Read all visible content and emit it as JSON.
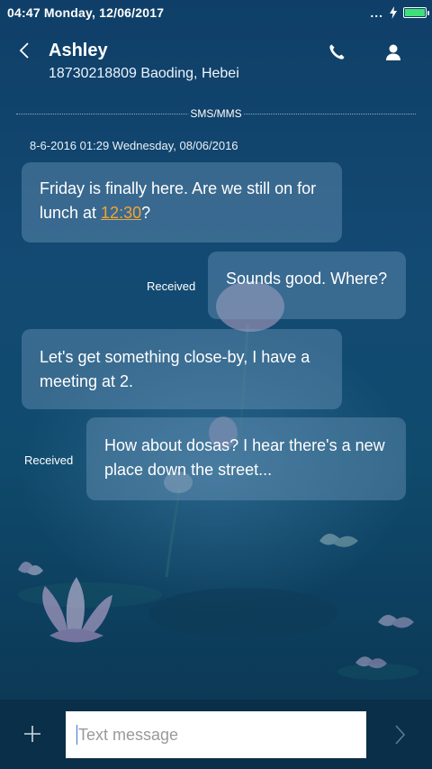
{
  "status": {
    "time": "04:47 Monday, 12/06/2017",
    "dots": "...",
    "battery_level": 1.0,
    "battery_color": "#3ee07a"
  },
  "header": {
    "name": "Ashley",
    "subtitle": "18730218809 Baoding, Hebei"
  },
  "thread": {
    "channel": "SMS/MMS",
    "timestamp": "8-6-2016 01:29 Wednesday, 08/06/2016"
  },
  "messages": [
    {
      "direction": "incoming",
      "text_before": "Friday is finally here. Are we still on for lunch at ",
      "link": "12:30",
      "text_after": "?"
    },
    {
      "direction": "outgoing",
      "status": "Received",
      "text": "Sounds good. Where?"
    },
    {
      "direction": "incoming",
      "text": "Let's get something close-by, I have a meeting at 2."
    },
    {
      "direction": "outgoing",
      "status": "Received",
      "text": "How about dosas? I hear there's a new place down the street..."
    }
  ],
  "composer": {
    "placeholder": "Text message"
  },
  "colors": {
    "accent_link": "#f3a531",
    "background": "#11426b"
  },
  "icons": {
    "back": "chevron-left-icon",
    "call": "phone-icon",
    "profile": "person-icon",
    "attach": "plus-icon",
    "send": "chevron-right-icon"
  }
}
